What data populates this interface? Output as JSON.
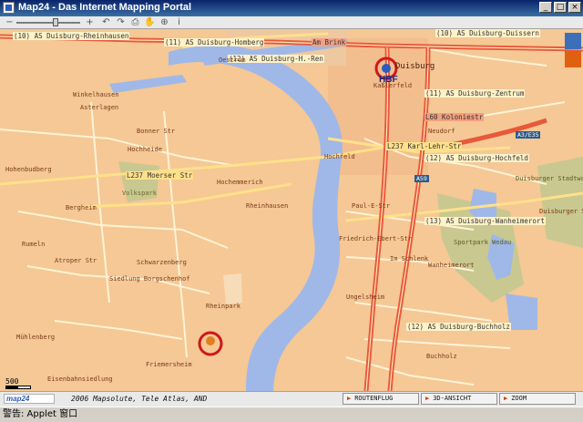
{
  "window": {
    "title": "Map24 - Das Internet Mapping Portal",
    "minimize_glyph": "_",
    "maximize_glyph": "□",
    "close_glyph": "×"
  },
  "toolbar": {
    "zoom_out_glyph": "−",
    "zoom_in_glyph": "+",
    "zoom_level_fraction": 0.63,
    "back_glyph": "↶",
    "forward_glyph": "↷",
    "print_glyph": "⎙",
    "pan_glyph": "✋",
    "zoombox_glyph": "⊕",
    "info_glyph": "i"
  },
  "map": {
    "colors": {
      "land": "#f5c895",
      "river": "#9fb8e8",
      "road_major": "#f07850",
      "road_minor": "#fff3d6",
      "park": "#c8c890",
      "hbf_circle": "#d01818"
    },
    "district_labels": [
      "(10) AS Duisburg-Rheinhausen",
      "(11) AS Duisburg-Homberg",
      "(12) AS Duisburg-H.-Ren",
      "(10) AS Duisburg-Duissern",
      "(11) AS Duisburg-Zentrum",
      "(12) AS Duisburg-Hochfeld",
      "(13) AS Duisburg-Wanheimerort",
      "(12) AS Duisburg-Buchholz"
    ],
    "place_labels": [
      "Duisburg",
      "HBF",
      "Volkspark",
      "Hochemmerich",
      "Rheinhausen",
      "Hochfeld",
      "Wanheimerort",
      "Buchholz",
      "Bergheim",
      "Schwarzenberg",
      "Rumeln",
      "Asterlagen",
      "Winkelhausen",
      "Hochheide",
      "Hohenbudberg",
      "Sportpark Wedau",
      "Duisburger Stadtwald",
      "Neudorf",
      "Kaßlerfeld",
      "Oestrum",
      "Siedlung Borgschenhof",
      "Mühlenberg",
      "Friemersheim",
      "Eisenbahnsiedlung",
      "Ungelsheim",
      "Im Schlenk"
    ],
    "road_labels": [
      "L237 Moerser Str",
      "L237 Karl-Lehr-Str",
      "L60 Koloniestr",
      "Am Brink",
      "A59",
      "A3/E35",
      "Paul-E-Str",
      "Bonner Str",
      "Atroper Str",
      "Friedrich-Ebert-Str",
      "Duisburger Str",
      "Rheinpark"
    ],
    "scale_label": "500"
  },
  "bottom": {
    "logo_text": "map24",
    "copyright": "2006 Mapsolute, Tele Atlas, AND",
    "nav_buttons": [
      {
        "label": "ROUTENFLUG"
      },
      {
        "label": "3D-ANSICHT"
      },
      {
        "label": "ZOOM"
      }
    ]
  },
  "statusbar": {
    "text": "警告: Applet 窗口"
  }
}
